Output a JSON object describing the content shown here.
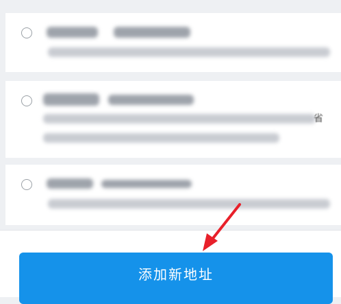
{
  "addresses": [
    {
      "selected": false,
      "content": "redacted"
    },
    {
      "selected": false,
      "content": "redacted",
      "edge_text": "省"
    },
    {
      "selected": false,
      "content": "redacted"
    }
  ],
  "bottom": {
    "add_button_label": "添加新地址"
  },
  "colors": {
    "button": "#1592ea",
    "arrow": "#e8202a",
    "background": "#eef0f3"
  }
}
